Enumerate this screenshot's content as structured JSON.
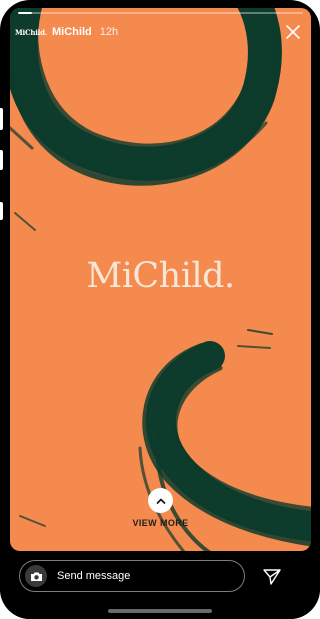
{
  "story": {
    "background_color": "#f58a4f",
    "brush_color": "#0d3b2c",
    "progress_fraction": 0.05,
    "account_name": "MiChild",
    "avatar_logo_text": "MiChild.",
    "time_ago": "12h",
    "brand_logo_text": "MiChild.",
    "view_more_label": "VIEW MORE"
  },
  "icons": {
    "close": "close-icon",
    "chevron_up": "chevron-up-icon",
    "camera": "camera-icon",
    "send": "send-icon"
  },
  "reply": {
    "placeholder": "Send message"
  }
}
